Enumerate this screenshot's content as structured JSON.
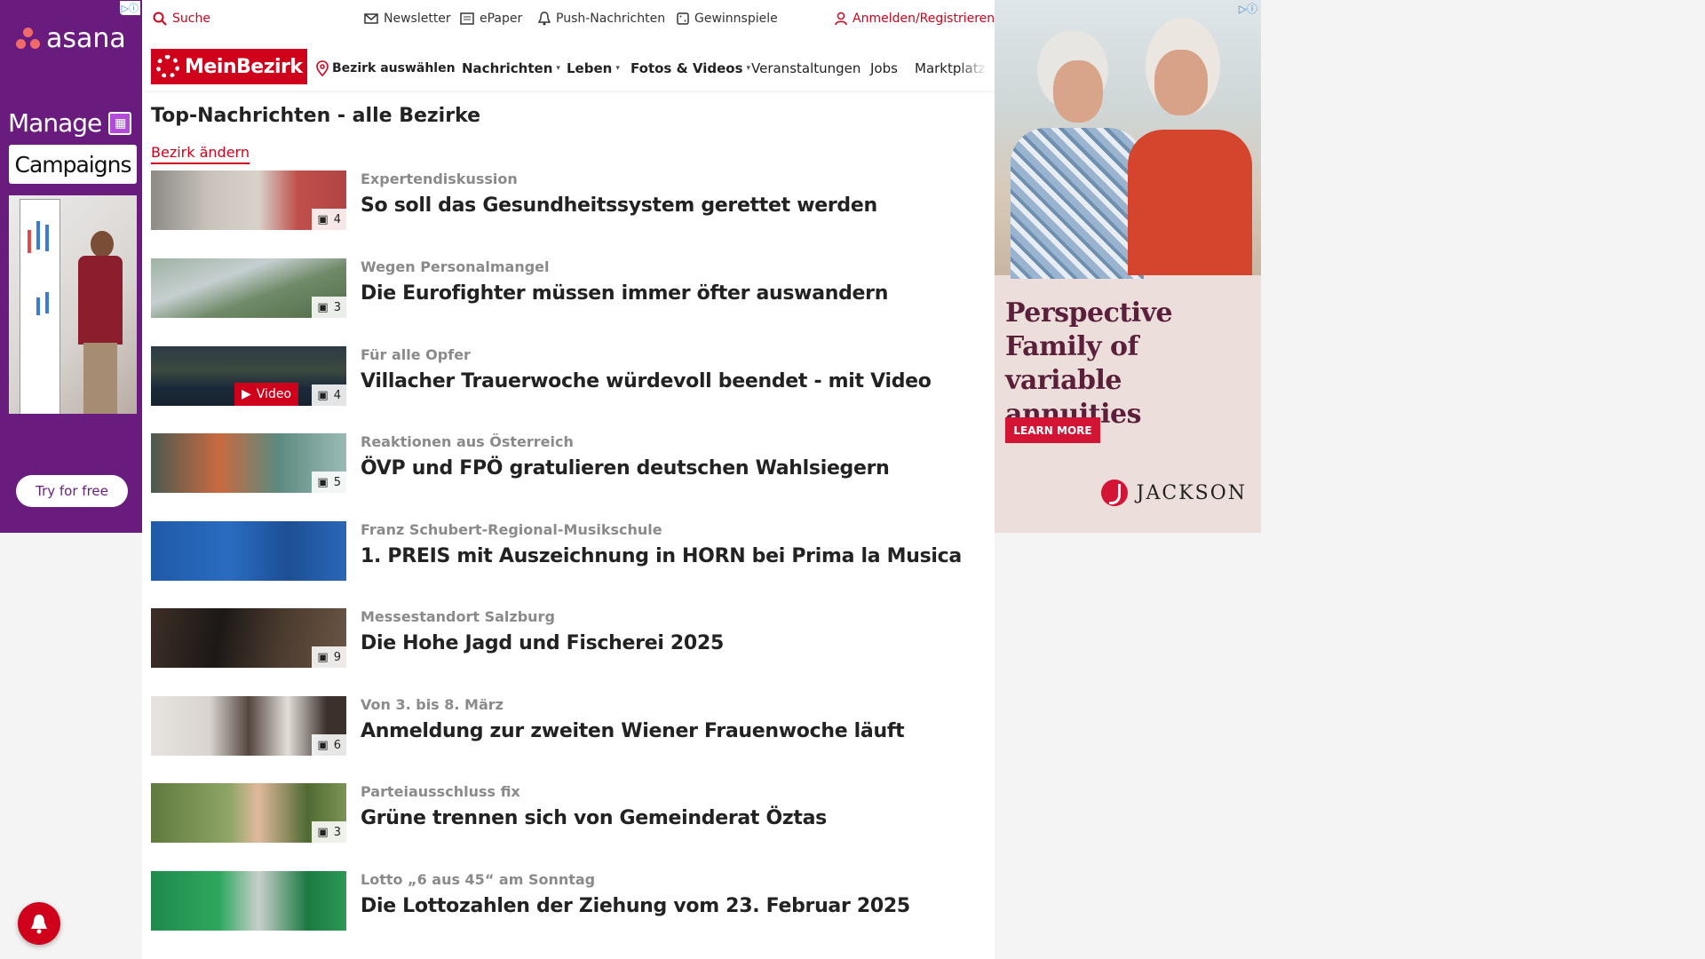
{
  "ad_left": {
    "adchoice": "▷ⓘ",
    "brand": "asana",
    "line1": "Manage",
    "line2": "Campaigns",
    "cta": "Try for free",
    "brand_color": "#6a1c7e"
  },
  "topbar": {
    "search": "Suche",
    "newsletter": "Newsletter",
    "epaper": "ePaper",
    "push": "Push-Nachrichten",
    "games": "Gewinnspiele",
    "login": "Anmelden/Registrieren"
  },
  "nav": {
    "logo": "MeinBezirk",
    "district": "Bezirk auswählen",
    "items": [
      "Nachrichten",
      "Leben",
      "Fotos & Videos",
      "Veranstaltungen",
      "Jobs",
      "Marktplatz"
    ]
  },
  "main": {
    "title": "Top-Nachrichten - alle Bezirke",
    "change_link": "Bezirk ändern",
    "articles": [
      {
        "kicker": "Expertendiskussion",
        "headline": "So soll das Gesundheitssystem gerettet werden",
        "photos": "4"
      },
      {
        "kicker": "Wegen Personalmangel",
        "headline": "Die Eurofighter müssen immer öfter auswandern",
        "photos": "3"
      },
      {
        "kicker": "Für alle Opfer",
        "headline": "Villacher Trauerwoche würdevoll beendet - mit Video",
        "photos": "4",
        "video": "Video"
      },
      {
        "kicker": "Reaktionen aus Österreich",
        "headline": "ÖVP und FPÖ gratulieren deutschen Wahlsiegern",
        "photos": "5"
      },
      {
        "kicker": "Franz Schubert-Regional-Musikschule",
        "headline": "1. PREIS mit Auszeichnung in HORN bei Prima la Musica",
        "photos": ""
      },
      {
        "kicker": "Messestandort Salzburg",
        "headline": "Die Hohe Jagd und Fischerei 2025",
        "photos": "9"
      },
      {
        "kicker": "Von 3. bis 8. März",
        "headline": "Anmeldung zur zweiten Wiener Frauenwoche läuft",
        "photos": "6"
      },
      {
        "kicker": "Parteiausschluss fix",
        "headline": "Grüne trennen sich von Gemeinderat Öztas",
        "photos": "3"
      },
      {
        "kicker": "Lotto „6 aus 45“ am Sonntag",
        "headline": "Die Lottozahlen der Ziehung vom 23. Februar 2025",
        "photos": ""
      }
    ]
  },
  "ad_right": {
    "adchoice": "▷ⓘ",
    "copy": "Perspective Family of variable annuities",
    "cta": "LEARN MORE",
    "brand": "JACKSON"
  },
  "accent_color": "#d0021b"
}
